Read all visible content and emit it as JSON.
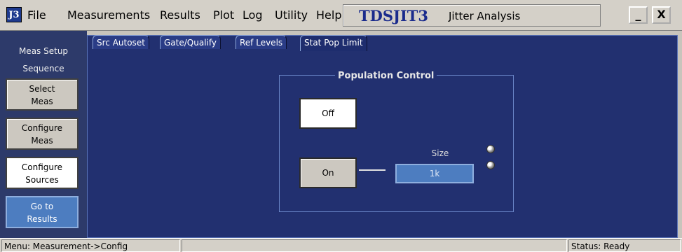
{
  "app": {
    "icon_text": "J3",
    "brand": "TDSJIT3",
    "subtitle": "Jitter Analysis",
    "minimize_label": "_",
    "close_label": "X"
  },
  "menu": [
    "File",
    "Measurements",
    "Results",
    "Plot",
    "Log",
    "Utility",
    "Help"
  ],
  "sidebar": {
    "title_line1": "Meas Setup",
    "title_line2": "Sequence",
    "buttons": [
      {
        "line1": "Select",
        "line2": "Meas",
        "state": "normal"
      },
      {
        "line1": "Configure",
        "line2": "Meas",
        "state": "normal"
      },
      {
        "line1": "Configure",
        "line2": "Sources",
        "state": "selected"
      },
      {
        "line1": "Go to",
        "line2": "Results",
        "state": "highlight"
      }
    ]
  },
  "tabs": [
    "Src Autoset",
    "Gate/Qualify",
    "Ref Levels",
    "Stat Pop Limit"
  ],
  "active_tab": "Stat Pop Limit",
  "population_control": {
    "title": "Population Control",
    "off_label": "Off",
    "on_label": "On",
    "size_label": "Size",
    "size_value": "1k"
  },
  "statusbar": {
    "menu_path": "Menu: Measurement->Config",
    "status": "Status: Ready"
  },
  "colors": {
    "panel_bg": "#223070",
    "sidebar_bg": "#2d3a6a",
    "accent_blue": "#4d7dc0",
    "brand_text": "#1a2b8c"
  }
}
